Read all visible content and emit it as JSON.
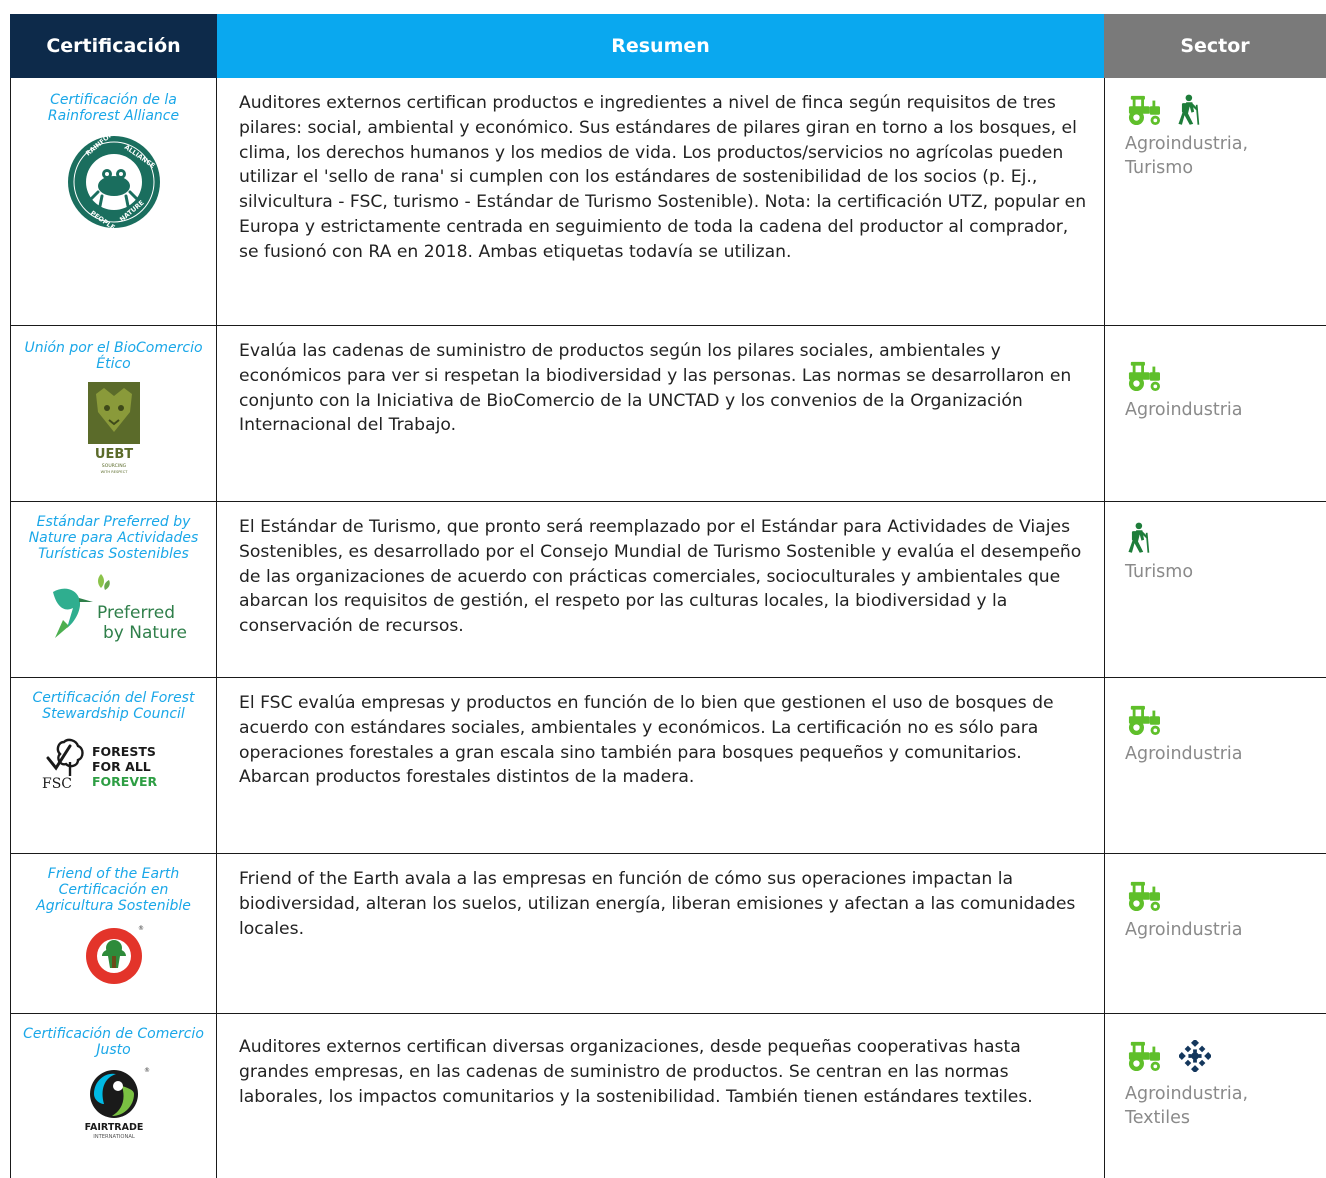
{
  "headers": {
    "certification": "Certificación",
    "summary": "Resumen",
    "sector": "Sector"
  },
  "colors": {
    "header_navy": "#0d2a4a",
    "header_blue": "#0aa8ef",
    "header_gray": "#7a7a7a",
    "cert_name": "#1aa7e8",
    "icon_green": "#5fbf2a",
    "icon_dark_green": "#1e7d3a",
    "icon_navy": "#14375c"
  },
  "rows": [
    {
      "name": "Certificación de la Rainforest Alliance",
      "logo": "rainforest-alliance-frog-seal",
      "logo_text": "RAINFOREST ALLIANCE · PEOPLE & NATURE",
      "summary": "Auditores externos certifican productos e ingredientes a nivel de finca según requisitos de tres pilares: social, ambiental y económico. Sus estándares de pilares giran en torno a los bosques, el clima, los derechos humanos y los medios de vida. Los productos/servicios no agrícolas pueden utilizar el 'sello de rana' si cumplen con los estándares de sostenibilidad de los socios (p. Ej., silvicultura - FSC, turismo - Estándar de Turismo Sostenible). Nota: la certificación UTZ, popular en Europa y estrictamente centrada en seguimiento de toda la cadena del productor al comprador, se fusionó con RA en 2018. Ambas etiquetas todavía se utilizan.",
      "sector_icons": [
        "tractor-icon",
        "hiker-icon"
      ],
      "sector_line1": "Agroindustria,",
      "sector_line2": "Turismo"
    },
    {
      "name": "Unión por el BioComercio Ético",
      "logo": "uebt-leopard",
      "logo_text": "UEBT",
      "logo_subtext": "SOURCING WITH RESPECT",
      "summary": "Evalúa las cadenas de suministro de productos según los pilares sociales, ambientales y económicos para ver si respetan la biodiversidad y las personas. Las normas se desarrollaron en conjunto con la Iniciativa de BioComercio de la UNCTAD y los convenios de la Organización Internacional del Trabajo.",
      "sector_icons": [
        "tractor-icon"
      ],
      "sector_line1": "Agroindustria",
      "sector_line2": ""
    },
    {
      "name": "Estándar Preferred by Nature para Actividades Turísticas Sostenibles",
      "logo": "preferred-by-nature-hummingbird",
      "logo_text": "Preferred",
      "logo_text2": "by Nature",
      "summary": "El Estándar de Turismo, que pronto será reemplazado por el Estándar para Actividades de Viajes Sostenibles, es desarrollado por el Consejo Mundial de Turismo Sostenible y evalúa el desempeño de las organizaciones de acuerdo con prácticas comerciales, socioculturales y ambientales que abarcan los requisitos de gestión, el respeto por las culturas locales, la biodiversidad y la conservación de recursos.",
      "sector_icons": [
        "hiker-icon"
      ],
      "sector_line1": "Turismo",
      "sector_line2": ""
    },
    {
      "name": "Certificación del Forest Stewardship Council",
      "logo": "fsc-tree-check",
      "logo_text": "FORESTS",
      "logo_text2": "FOR ALL",
      "logo_text3": "FOREVER",
      "logo_fsc": "FSC",
      "summary": "El FSC evalúa empresas y productos en función de lo bien que gestionen el uso de bosques de acuerdo con estándares sociales, ambientales y económicos. La certificación no es sólo para operaciones forestales a gran escala sino también para bosques pequeños y comunitarios. Abarcan productos forestales distintos de la madera.",
      "sector_icons": [
        "tractor-icon"
      ],
      "sector_line1": "Agroindustria",
      "sector_line2": ""
    },
    {
      "name": "Friend of the Earth Certificación en Agricultura Sostenible",
      "logo": "friend-of-the-earth-seal",
      "summary": "Friend of the Earth avala a las empresas en función de cómo sus operaciones impactan la biodiversidad, alteran los suelos, utilizan energía, liberan emisiones y afectan a las comunidades locales.",
      "sector_icons": [
        "tractor-icon"
      ],
      "sector_line1": "Agroindustria",
      "sector_line2": ""
    },
    {
      "name": "Certificación de Comercio Justo",
      "logo": "fairtrade-mark",
      "logo_text": "FAIRTRADE",
      "logo_subtext": "INTERNATIONAL",
      "summary": "Auditores externos certifican diversas organizaciones, desde pequeñas cooperativas hasta grandes empresas, en las cadenas de suministro de productos. Se centran en las normas laborales, los impactos comunitarios y la sostenibilidad. También tienen estándares textiles.",
      "sector_icons": [
        "tractor-icon",
        "textile-pattern-icon"
      ],
      "sector_line1": "Agroindustria,",
      "sector_line2": "Textiles"
    }
  ]
}
